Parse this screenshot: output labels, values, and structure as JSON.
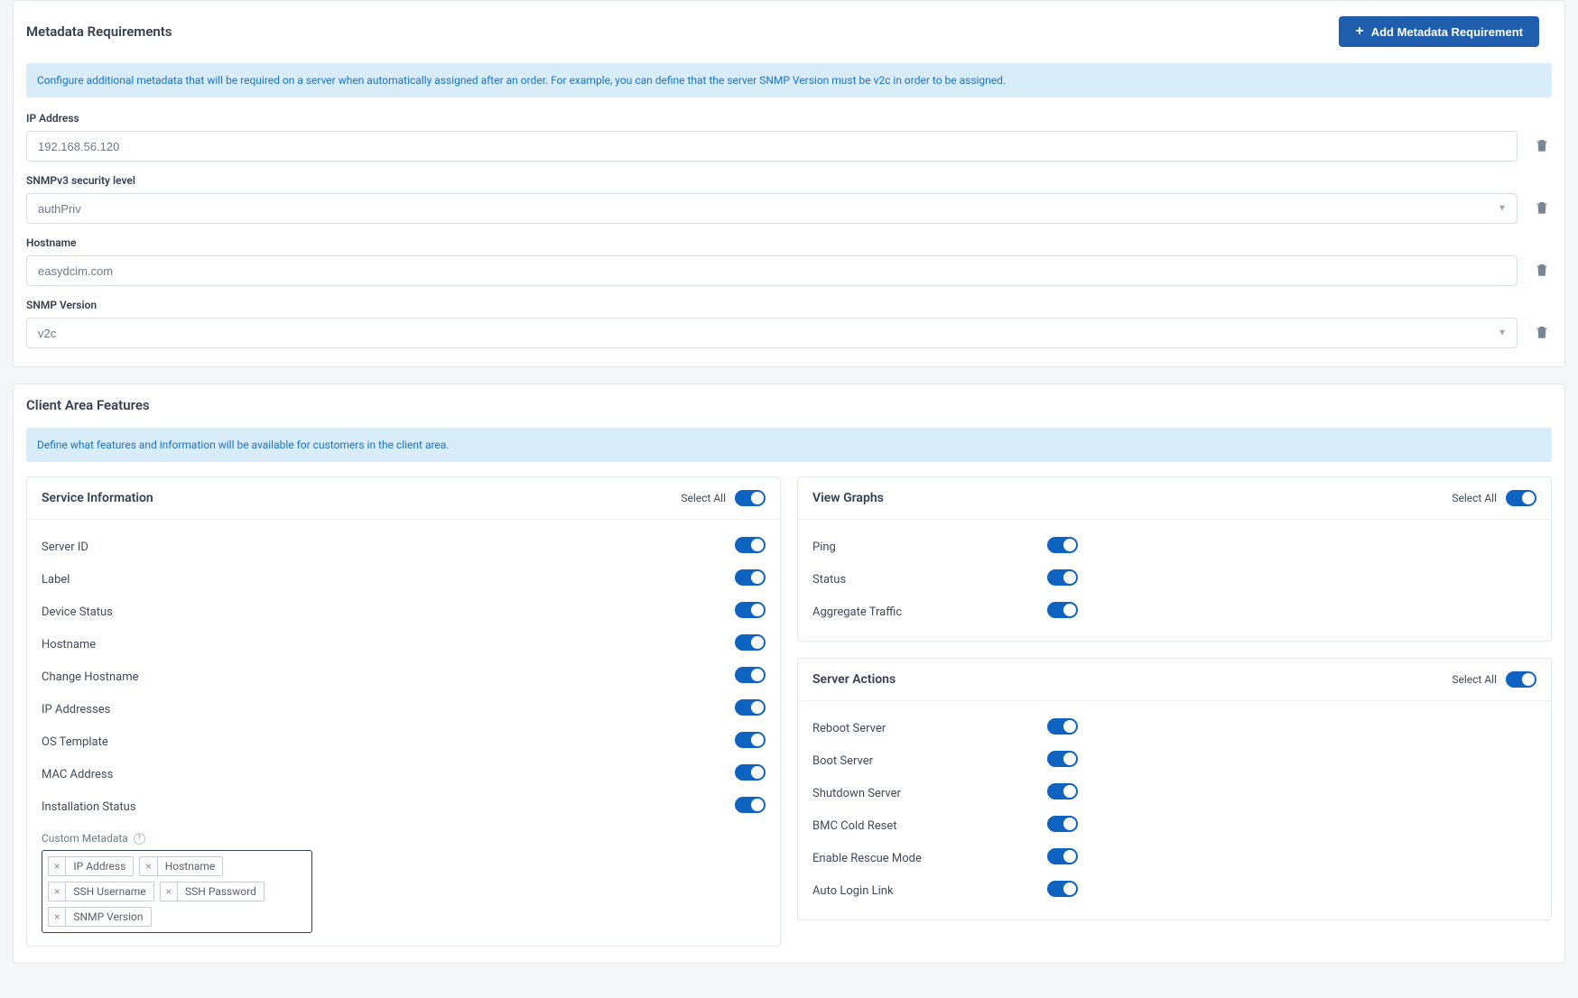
{
  "metadata": {
    "title": "Metadata Requirements",
    "add_button": "Add Metadata Requirement",
    "info": "Configure additional metadata that will be required on a server when automatically assigned after an order. For example, you can define that the server SNMP Version must be v2c in order to be assigned.",
    "fields": {
      "ip_label": "IP Address",
      "ip_value": "192.168.56.120",
      "snmpv3_label": "SNMPv3 security level",
      "snmpv3_value": "authPriv",
      "hostname_label": "Hostname",
      "hostname_value": "easydcim.com",
      "snmpver_label": "SNMP Version",
      "snmpver_value": "v2c"
    }
  },
  "client_area": {
    "title": "Client Area Features",
    "info": "Define what features and information will be available for customers in the client area.",
    "select_all_label": "Select All",
    "service_info": {
      "title": "Service Information",
      "items": [
        "Server ID",
        "Label",
        "Device Status",
        "Hostname",
        "Change Hostname",
        "IP Addresses",
        "OS Template",
        "MAC Address",
        "Installation Status"
      ],
      "custom_meta_label": "Custom Metadata",
      "tags": [
        "IP Address",
        "Hostname",
        "SSH Username",
        "SSH Password",
        "SNMP Version"
      ]
    },
    "view_graphs": {
      "title": "View Graphs",
      "items": [
        "Ping",
        "Status",
        "Aggregate Traffic"
      ]
    },
    "server_actions": {
      "title": "Server Actions",
      "items": [
        "Reboot Server",
        "Boot Server",
        "Shutdown Server",
        "BMC Cold Reset",
        "Enable Rescue Mode",
        "Auto Login Link"
      ]
    }
  }
}
